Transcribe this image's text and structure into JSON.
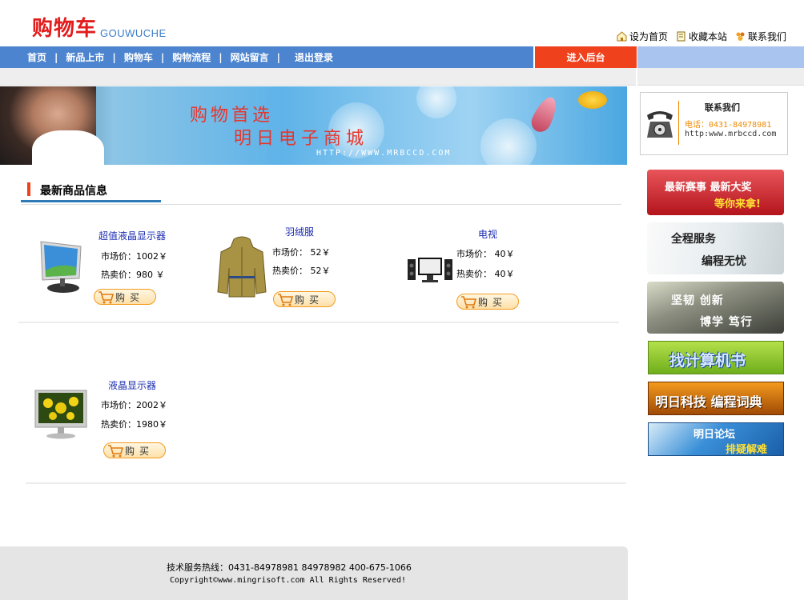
{
  "header": {
    "logo_cn": "购物车",
    "logo_en": "GOUWUCHE",
    "links": [
      "设为首页",
      "收藏本站",
      "联系我们"
    ]
  },
  "nav": {
    "items": [
      "首页",
      "新品上市",
      "购物车",
      "购物流程",
      "网站留言",
      "退出登录"
    ],
    "admin": "进入后台"
  },
  "banner": {
    "line1": "购物首选",
    "line2": "明日电子商城",
    "url": "HTTP://WWW.MRBCCD.COM"
  },
  "section": {
    "title": "最新商品信息"
  },
  "products": [
    {
      "name": "超值液晶显示器",
      "market": "市场价：1002￥",
      "sale": "热卖价：980 ￥",
      "buy": "购买"
    },
    {
      "name": "羽绒服",
      "market": "市场价： 52￥",
      "sale": "热卖价： 52￥",
      "buy": "购买"
    },
    {
      "name": "电视",
      "market": "市场价： 40￥",
      "sale": "热卖价： 40￥",
      "buy": "购买"
    },
    {
      "name": "液晶显示器",
      "market": "市场价：2002￥",
      "sale": "热卖价：1980￥",
      "buy": "购买"
    }
  ],
  "sidebar": {
    "contact_title": "联系我们",
    "contact_phone": "电话：0431-84978981",
    "contact_web": "http:www.mrbccd.com",
    "ads": [
      {
        "l1": "最新赛事 最新大奖",
        "l2": "等你来拿!"
      },
      {
        "l1": "全程服务",
        "l2": "编程无忧"
      },
      {
        "l1": "坚韧  创新",
        "l2": "博学  笃行"
      },
      {
        "l1": "找计算机书",
        "l2": ""
      },
      {
        "l1": "明日科技 编程词典",
        "l2": ""
      },
      {
        "l1": "明日论坛",
        "l2": "排疑解难"
      }
    ]
  },
  "footer": {
    "hotline": "技术服务热线：0431-84978981  84978982 400-675-1066",
    "copyright": "Copyright©www.mingrisoft.com All Rights Reserved!"
  }
}
